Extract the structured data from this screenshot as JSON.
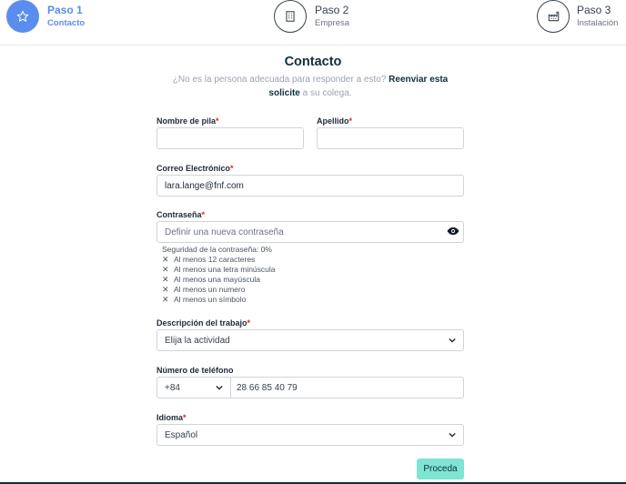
{
  "stepper": {
    "steps": [
      {
        "title": "Paso 1",
        "subtitle": "Contacto",
        "icon": "star-icon",
        "state": "active"
      },
      {
        "title": "Paso 2",
        "subtitle": "Empresa",
        "icon": "building-icon",
        "state": "inactive"
      },
      {
        "title": "Paso 3",
        "subtitle": "Instalación",
        "icon": "factory-icon",
        "state": "inactive"
      }
    ]
  },
  "heading": {
    "title": "Contacto",
    "subtitle_before": "¿No es la persona adecuada para responder a esto? ",
    "subtitle_link": "Reenviar esta solicite",
    "subtitle_after": " a su colega."
  },
  "form": {
    "first_name": {
      "label": "Nombre de pila",
      "value": ""
    },
    "last_name": {
      "label": "Apellido",
      "value": ""
    },
    "email": {
      "label": "Correo Electrónico",
      "value": "lara.lange@fnf.com"
    },
    "password": {
      "label": "Contraseña",
      "placeholder": "Definir una nueva contraseña",
      "strength": "Seguridad de la contraseña: 0%",
      "rules": [
        "Al menos 12 caracteres",
        "Al menos una letra minúscula",
        "Al menos una mayúscula",
        "Al menos un numero",
        "Al menos un símbolo"
      ]
    },
    "job": {
      "label": "Descripción del trabajo",
      "value": "Elija la actividad"
    },
    "phone": {
      "label": "Número de teléfono",
      "code": "+84",
      "number": "28 66 85 40 79"
    },
    "language": {
      "label": "Idioma",
      "value": "Español"
    },
    "required_mark": "*"
  },
  "actions": {
    "submit_label": "Proceda"
  },
  "colors": {
    "accent": "#5b8def",
    "button": "#7ee5d4",
    "required": "#dc2626",
    "dark": "#0f2f3a"
  }
}
